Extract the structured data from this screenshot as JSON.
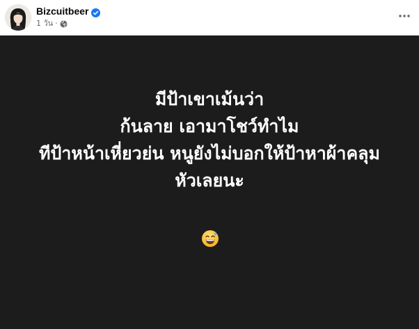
{
  "post": {
    "author": "Bizcuitbeer",
    "verified": true,
    "timestamp": "1 วัน",
    "separator": "·",
    "audience_icon": "globe-icon",
    "more_icon": "more-horizontal-icon"
  },
  "image": {
    "background": "#1c1c1c",
    "lines": [
      "มีป้าเขาเม้นว่า",
      "ก้นลาย เอามาโชว์ทำไม",
      "ทีป้าหน้าเหี่ยวย่น หนูยังไม่บอกให้ป้าหาผ้าคลุม",
      "หัวเลยนะ"
    ],
    "emoji": "grinning-face-with-sweat-emoji"
  },
  "colors": {
    "verified_badge": "#1877f2",
    "meta_text": "#65676b",
    "name_text": "#050505"
  }
}
